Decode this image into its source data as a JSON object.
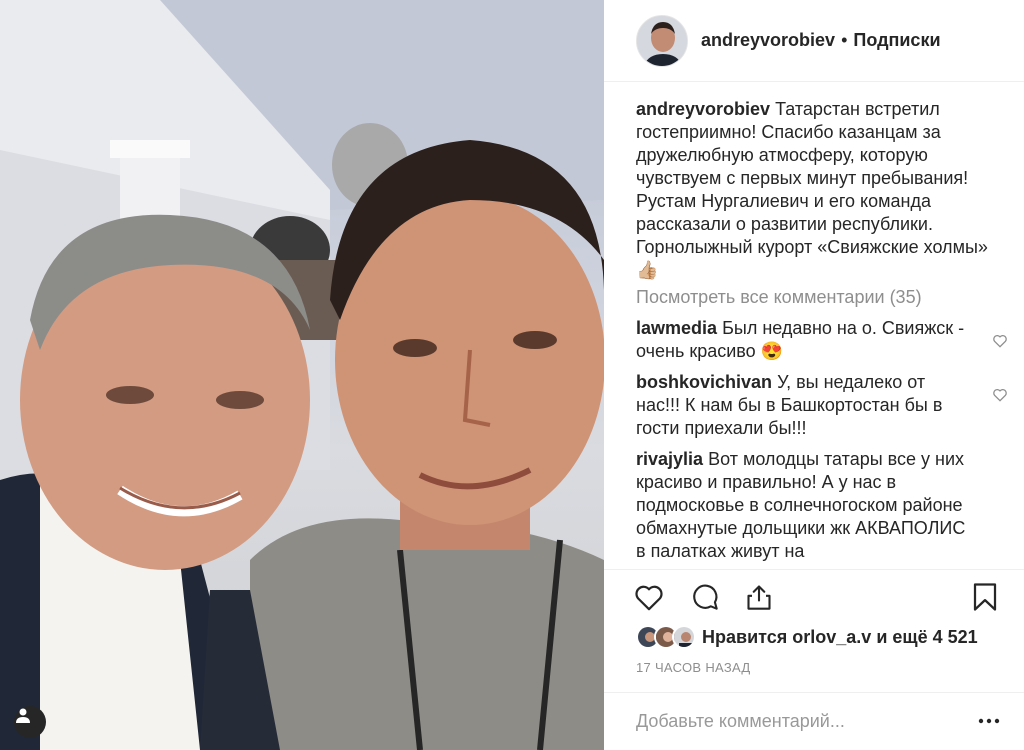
{
  "post": {
    "username": "andreyvorobiev",
    "separator": "•",
    "follow_label": "Подписки",
    "caption_user": "andreyvorobiev",
    "caption_text": "Татарстан встретил гостеприимно! Спасибо казанцам за дружелюбную атмосферу, которую чувствуем с первых минут пребывания! Рустам Нургалиевич и его команда рассказали о развитии республики. Горнолыжный курорт «Свияжские холмы» 👍🏼",
    "view_all_label": "Посмотреть все комментарии (35)",
    "comments": [
      {
        "user": "lawmedia",
        "text": "Был недавно на о. Свияжск - очень красиво 😍"
      },
      {
        "user": "boshkovichivan",
        "text": "У, вы недалеко от нас!!! К нам бы в Башкортостан бы в гости приехали бы!!!"
      },
      {
        "user": "rivajylia",
        "text": "Вот молодцы татары все у них красиво и правильно! А у нас в подмосковье в солнечногоском районе обмахнутые дольщики жк АКВАПОЛИС в палатках живут на"
      }
    ],
    "likes_prefix": "Нравится",
    "likes_user": "orlov_a.v",
    "likes_suffix": "и ещё 4 521",
    "time_ago": "17 ЧАСОВ НАЗАД",
    "add_comment_placeholder": "Добавьте комментарий...",
    "more_label": "•••"
  },
  "icons": {
    "like": "heart-icon",
    "comment": "comment-icon",
    "share": "share-icon",
    "save": "bookmark-icon",
    "user_tag": "user-icon"
  },
  "colors": {
    "text": "#262626",
    "muted": "#8e8e8e",
    "border": "#efefef"
  }
}
